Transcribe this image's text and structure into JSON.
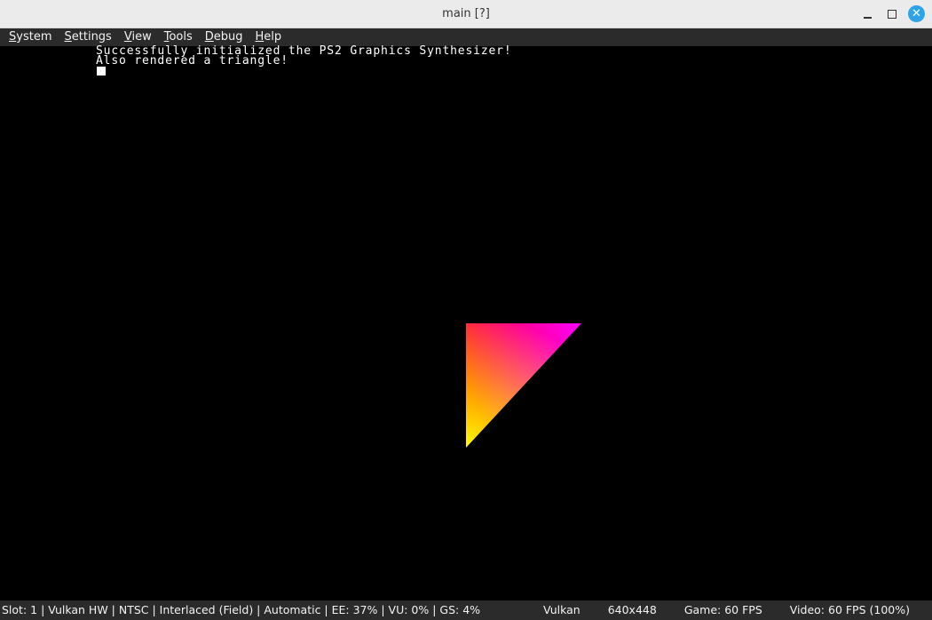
{
  "window": {
    "title": "main [?]"
  },
  "menu": {
    "items": [
      {
        "label_u": "S",
        "label_rest": "ystem"
      },
      {
        "label_u": "S",
        "label_rest": "ettings"
      },
      {
        "label_u": "V",
        "label_rest": "iew"
      },
      {
        "label_u": "T",
        "label_rest": "ools"
      },
      {
        "label_u": "D",
        "label_rest": "ebug"
      },
      {
        "label_u": "H",
        "label_rest": "elp"
      }
    ]
  },
  "console": {
    "line1": "Successfully initialized the PS2 Graphics Synthesizer!",
    "line2": "Also rendered a triangle!"
  },
  "triangle": {
    "vertex_colors": [
      "#ff0000",
      "#0000ff",
      "#00ff00"
    ]
  },
  "status": {
    "left": "Slot: 1 | Vulkan HW | NTSC | Interlaced (Field) | Automatic | EE: 37% | VU: 0% | GS: 4%",
    "renderer": "Vulkan",
    "resolution": "640x448",
    "game_fps": "Game: 60 FPS",
    "video_fps": "Video: 60 FPS (100%)"
  },
  "icons": {
    "minimize": "minimize-icon",
    "maximize": "maximize-icon",
    "close": "close-icon"
  }
}
